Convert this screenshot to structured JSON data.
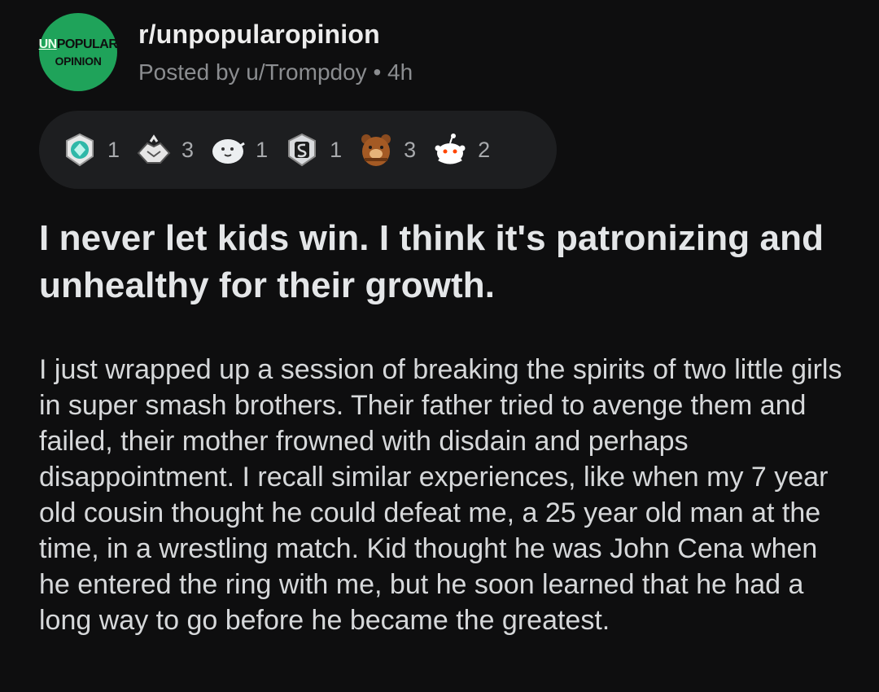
{
  "post": {
    "subreddit": "r/unpopularopinion",
    "posted_by": "Posted by u/Trompdoy",
    "separator": "•",
    "age": "4h",
    "avatar_text_un": "UN",
    "avatar_text_popular": "POPULAR",
    "avatar_text_opinion": "OPINION",
    "title": "I never let kids win. I think it's patronizing and unhealthy for their growth.",
    "body": "I just wrapped up a session of breaking the spirits of two little girls in super smash brothers.  Their father tried to avenge them and failed, their mother frowned with disdain and perhaps disappointment.  I recall similar experiences, like when my 7 year old cousin thought he could defeat me, a 25 year old man at the time, in a wrestling match.  Kid thought he was John Cena when he entered the ring with me, but he soon learned that he had a long way to go before he became the greatest."
  },
  "awards": [
    {
      "icon": "gem-badge-icon",
      "count": "1"
    },
    {
      "icon": "handshake-icon",
      "count": "3"
    },
    {
      "icon": "seal-icon",
      "count": "1"
    },
    {
      "icon": "silver-badge-icon",
      "count": "1"
    },
    {
      "icon": "bear-icon",
      "count": "3"
    },
    {
      "icon": "snoo-hugz-icon",
      "count": "2"
    }
  ],
  "colors": {
    "background": "#0e0e0f",
    "avatar_green": "#1fa35a",
    "pill": "#1d1e20"
  }
}
